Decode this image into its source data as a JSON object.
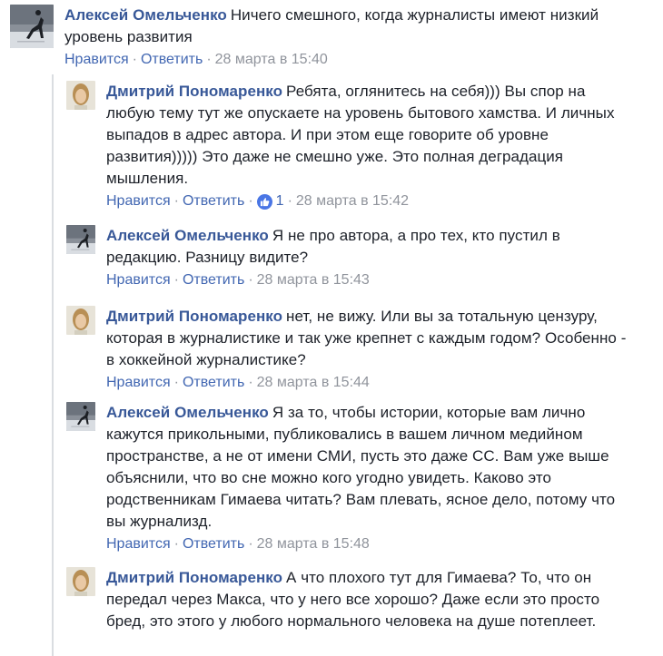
{
  "comments": [
    {
      "author": "Алексей Омельченко",
      "text": "Ничего смешного, когда журналисты имеют низкий уровень развития",
      "like_label": "Нравится",
      "reply_label": "Ответить",
      "timestamp": "28 марта в 15:40",
      "avatar": "skater-avatar"
    },
    {
      "author": "Дмитрий Пономаренко",
      "text": "Ребята, оглянитесь на себя))) Вы спор на любую тему тут же опускаете на уровень бытового хамства. И личных выпадов в адрес автора. И при этом еще говорите об уровне развития))))) Это даже не смешно уже. Это полная деградация мышления.",
      "like_label": "Нравится",
      "reply_label": "Ответить",
      "reactions": "1",
      "timestamp": "28 марта в 15:42",
      "avatar": "portrait-avatar"
    },
    {
      "author": "Алексей Омельченко",
      "text": "Я не про автора, а про тех, кто пустил в редакцию. Разницу видите?",
      "like_label": "Нравится",
      "reply_label": "Ответить",
      "timestamp": "28 марта в 15:43",
      "avatar": "skater-avatar"
    },
    {
      "author": "Дмитрий Пономаренко",
      "text": "нет, не вижу. Или вы за тотальную цензуру, которая в журналистике и так уже крепнет с каждым годом? Особенно - в хоккейной журналистике?",
      "like_label": "Нравится",
      "reply_label": "Ответить",
      "timestamp": "28 марта в 15:44",
      "avatar": "portrait-avatar"
    },
    {
      "author": "Алексей Омельченко",
      "text": "Я за то, чтобы истории, которые вам лично кажутся прикольными, публиковались в вашем личном медийном пространстве, а не от имени СМИ, пусть это даже СС. Вам уже выше объяснили, что во сне можно кого угодно увидеть. Каково это родственникам Гимаева читать? Вам плевать, ясное дело, потому что вы журнализд.",
      "like_label": "Нравится",
      "reply_label": "Ответить",
      "timestamp": "28 марта в 15:48",
      "avatar": "skater-avatar"
    },
    {
      "author": "Дмитрий Пономаренко",
      "text": "А что плохого тут для Гимаева? То, что он передал через Макса, что у него все хорошо? Даже если это просто бред, это этого у любого нормального человека на душе потеплеет.",
      "avatar": "portrait-avatar"
    }
  ],
  "colors": {
    "author": "#385898",
    "link": "#4267b2",
    "meta": "#90949c",
    "text": "#1d2129",
    "like_badge": "#4a76e5"
  }
}
